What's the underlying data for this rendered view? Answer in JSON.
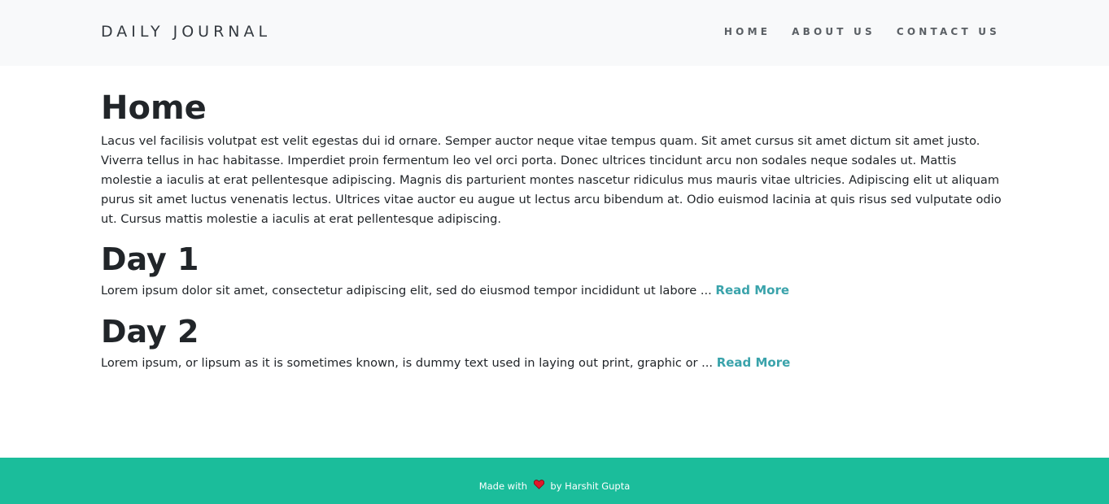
{
  "navbar": {
    "brand": "DAILY JOURNAL",
    "links": [
      {
        "label": "HOME"
      },
      {
        "label": "ABOUT US"
      },
      {
        "label": "CONTACT US"
      }
    ]
  },
  "main": {
    "title": "Home",
    "intro": "Lacus vel facilisis volutpat est velit egestas dui id ornare. Semper auctor neque vitae tempus quam. Sit amet cursus sit amet dictum sit amet justo. Viverra tellus in hac habitasse. Imperdiet proin fermentum leo vel orci porta. Donec ultrices tincidunt arcu non sodales neque sodales ut. Mattis molestie a iaculis at erat pellentesque adipiscing. Magnis dis parturient montes nascetur ridiculus mus mauris vitae ultricies. Adipiscing elit ut aliquam purus sit amet luctus venenatis lectus. Ultrices vitae auctor eu augue ut lectus arcu bibendum at. Odio euismod lacinia at quis risus sed vulputate odio ut. Cursus mattis molestie a iaculis at erat pellentesque adipiscing.",
    "posts": [
      {
        "title": "Day 1",
        "excerpt": "Lorem ipsum dolor sit amet, consectetur adipiscing elit, sed do eiusmod tempor incididunt ut labore ... ",
        "read_more": "Read More"
      },
      {
        "title": "Day 2",
        "excerpt": "Lorem ipsum, or lipsum as it is sometimes known, is dummy text used in laying out print, graphic or ... ",
        "read_more": "Read More"
      }
    ]
  },
  "footer": {
    "prefix": "Made with",
    "icon": "heart-icon",
    "suffix": "by Harshit Gupta"
  },
  "colors": {
    "navbar_bg": "#f8f9fa",
    "footer_bg": "#1bbd9b",
    "link_accent": "#3aa3ab",
    "heart": "#e0192b"
  }
}
